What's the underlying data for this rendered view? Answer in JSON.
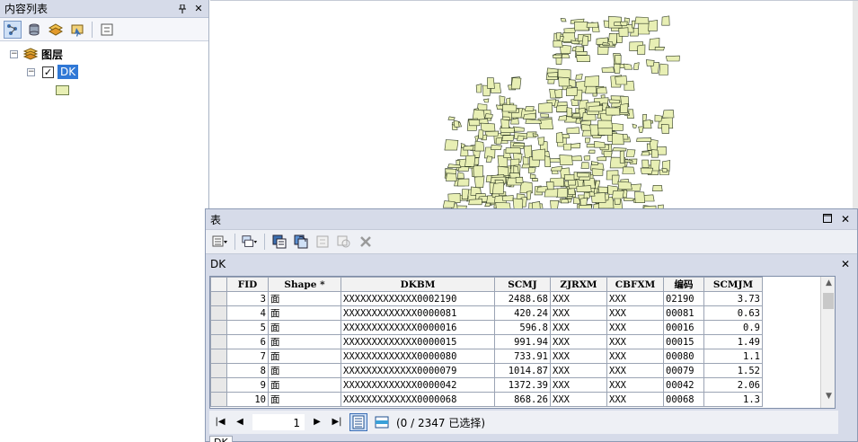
{
  "toc": {
    "title": "内容列表",
    "pin": "ᵖ",
    "close": "✕",
    "root_label": "图层",
    "layer_name": "DK",
    "expander_root": "−",
    "expander_layer": "−",
    "check_mark": "✓",
    "symbol_color": "#e8efb4"
  },
  "table_window": {
    "title": "表",
    "tab_label": "DK",
    "footer_tab": "DK",
    "columns": [
      "FID",
      "Shape *",
      "DKBM",
      "SCMJ",
      "ZJRXM",
      "CBFXM",
      "编码",
      "SCMJM"
    ],
    "rows": [
      [
        "3",
        "面",
        "XXXXXXXXXXXXX0002190",
        "2488.68",
        "XXX",
        "XXX",
        "02190",
        "3.73"
      ],
      [
        "4",
        "面",
        "XXXXXXXXXXXXX0000081",
        "420.24",
        "XXX",
        "XXX",
        "00081",
        "0.63"
      ],
      [
        "5",
        "面",
        "XXXXXXXXXXXXX0000016",
        "596.8",
        "XXX",
        "XXX",
        "00016",
        "0.9"
      ],
      [
        "6",
        "面",
        "XXXXXXXXXXXXX0000015",
        "991.94",
        "XXX",
        "XXX",
        "00015",
        "1.49"
      ],
      [
        "7",
        "面",
        "XXXXXXXXXXXXX0000080",
        "733.91",
        "XXX",
        "XXX",
        "00080",
        "1.1"
      ],
      [
        "8",
        "面",
        "XXXXXXXXXXXXX0000079",
        "1014.87",
        "XXX",
        "XXX",
        "00079",
        "1.52"
      ],
      [
        "9",
        "面",
        "XXXXXXXXXXXXX0000042",
        "1372.39",
        "XXX",
        "XXX",
        "00042",
        "2.06"
      ],
      [
        "10",
        "面",
        "XXXXXXXXXXXXX0000068",
        "868.26",
        "XXX",
        "XXX",
        "00068",
        "1.3"
      ]
    ],
    "record_number": "1",
    "selection_status": "(0 / 2347 已选择)"
  },
  "map": {
    "parcel_fill": "#e8efb4",
    "parcel_stroke": "#2f3a24"
  }
}
